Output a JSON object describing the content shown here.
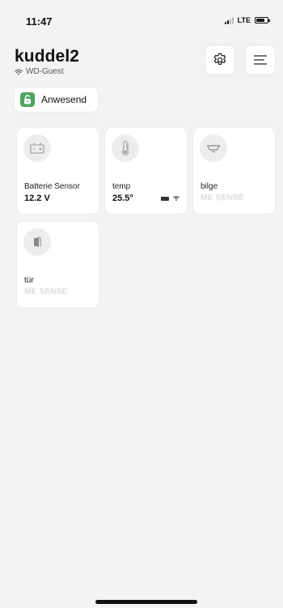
{
  "status": {
    "time": "11:47",
    "carrier": "LTE"
  },
  "header": {
    "title": "kuddel2",
    "network": "WD-Guest"
  },
  "presence": {
    "label": "Anwesend"
  },
  "devices": [
    {
      "label": "Batterie Sensor",
      "value": "12.2 V",
      "icon": "battery-icon"
    },
    {
      "label": "temp",
      "value": "25.5°",
      "icon": "thermometer-icon"
    },
    {
      "label": "bilge",
      "value": "ME SENSE",
      "icon": "sensor-icon"
    },
    {
      "label": "tür",
      "value": "ME SENSE",
      "icon": "door-icon"
    }
  ],
  "colors": {
    "background": "#f3f3f5",
    "accent_green": "#4fa463",
    "card": "#ffffff"
  }
}
